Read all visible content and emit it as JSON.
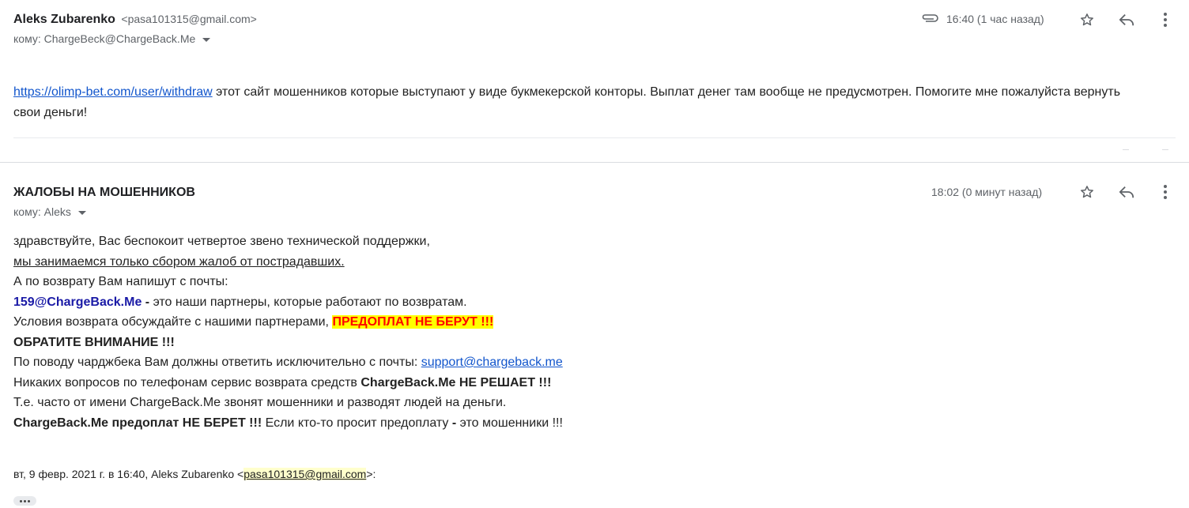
{
  "message1": {
    "sender_name": "Aleks Zubarenko",
    "sender_email": "<pasa101315@gmail.com>",
    "to": "кому: ChargeBeck@ChargeBack.Me",
    "time": "16:40 (1 час назад)",
    "body_link": "https://olimp-bet.com/user/withdraw",
    "body_text": " этот сайт мошенников которые выступают у виде букмекерской конторы. Выплат денег там вообще не предусмотрен. Помогите мне пожалуйста вернуть свои деньги!"
  },
  "message2": {
    "sender_name": "ЖАЛОБЫ НА МОШЕННИКОВ",
    "to": "кому: Aleks",
    "time": "18:02 (0 минут назад)",
    "line1": "здравствуйте, Вас беспокоит четвертое звено технической поддержки,",
    "line2": "мы занимаемся только сбором жалоб от пострадавших.",
    "line3": "А по возврату Вам напишут с почты:",
    "line4_email": "159@ChargeBack.Me",
    "line4_dash": " - ",
    "line4_rest": "это наши партнеры, которые работают по возвратам.",
    "line5_text": "Условия возврата обсуждайте с нашими партнерами, ",
    "line5_highlight": "ПРЕДОПЛАТ НЕ БЕРУТ !!!",
    "line6": "ОБРАТИТЕ ВНИМАНИЕ !!!",
    "line7_text": "По поводу чарджбека Вам должны ответить исключительно с почты: ",
    "line7_link": "support@chargeback.me",
    "line8_text": "Никаких вопросов по телефонам сервис возврата средств ",
    "line8_bold": "ChargeBack.Me НЕ РЕШАЕТ !!!",
    "line9": "Т.е. часто от имени ChargeBack.Me звонят мошенники и разводят людей на деньги.",
    "line10_bold": "ChargeBack.Me предоплат НЕ БЕРЕТ !!!",
    "line10_text": " Если кто-то просит предоплату ",
    "line10_dash": "-",
    "line10_end": " это мошенники !!!",
    "quote_prefix": "вт, 9 февр. 2021 г. в 16:40, Aleks Zubarenko <",
    "quote_email": "pasa101315@gmail.com",
    "quote_suffix": ">:"
  },
  "icons": {
    "attachment": "attachment-icon",
    "star": "star-icon",
    "reply": "reply-icon",
    "more": "more-vert-icon",
    "expand": "show-trimmed-content"
  }
}
